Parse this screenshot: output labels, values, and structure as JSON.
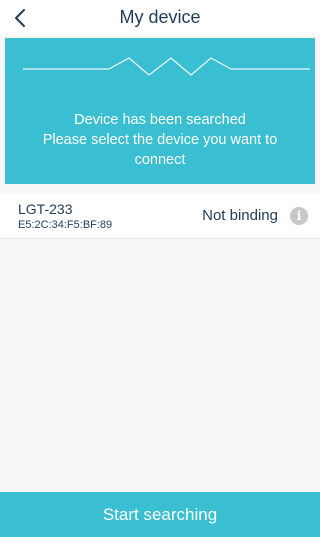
{
  "header": {
    "title": "My device",
    "back_icon": "chevron-left-icon"
  },
  "banner": {
    "line1": "Device has been searched",
    "line2": "Please select the device you want to connect",
    "background_color": "#39bfd1",
    "decoration": "zigzag-wave-icon"
  },
  "devices": [
    {
      "name": "LGT-233",
      "mac": "E5:2C:34:F5:BF:89",
      "status": "Not binding",
      "info_icon": "info-icon"
    }
  ],
  "footer": {
    "start_label": "Start searching"
  },
  "colors": {
    "accent": "#39bfd1",
    "text": "#1f3d58",
    "info_icon": "#c8c8c8"
  }
}
